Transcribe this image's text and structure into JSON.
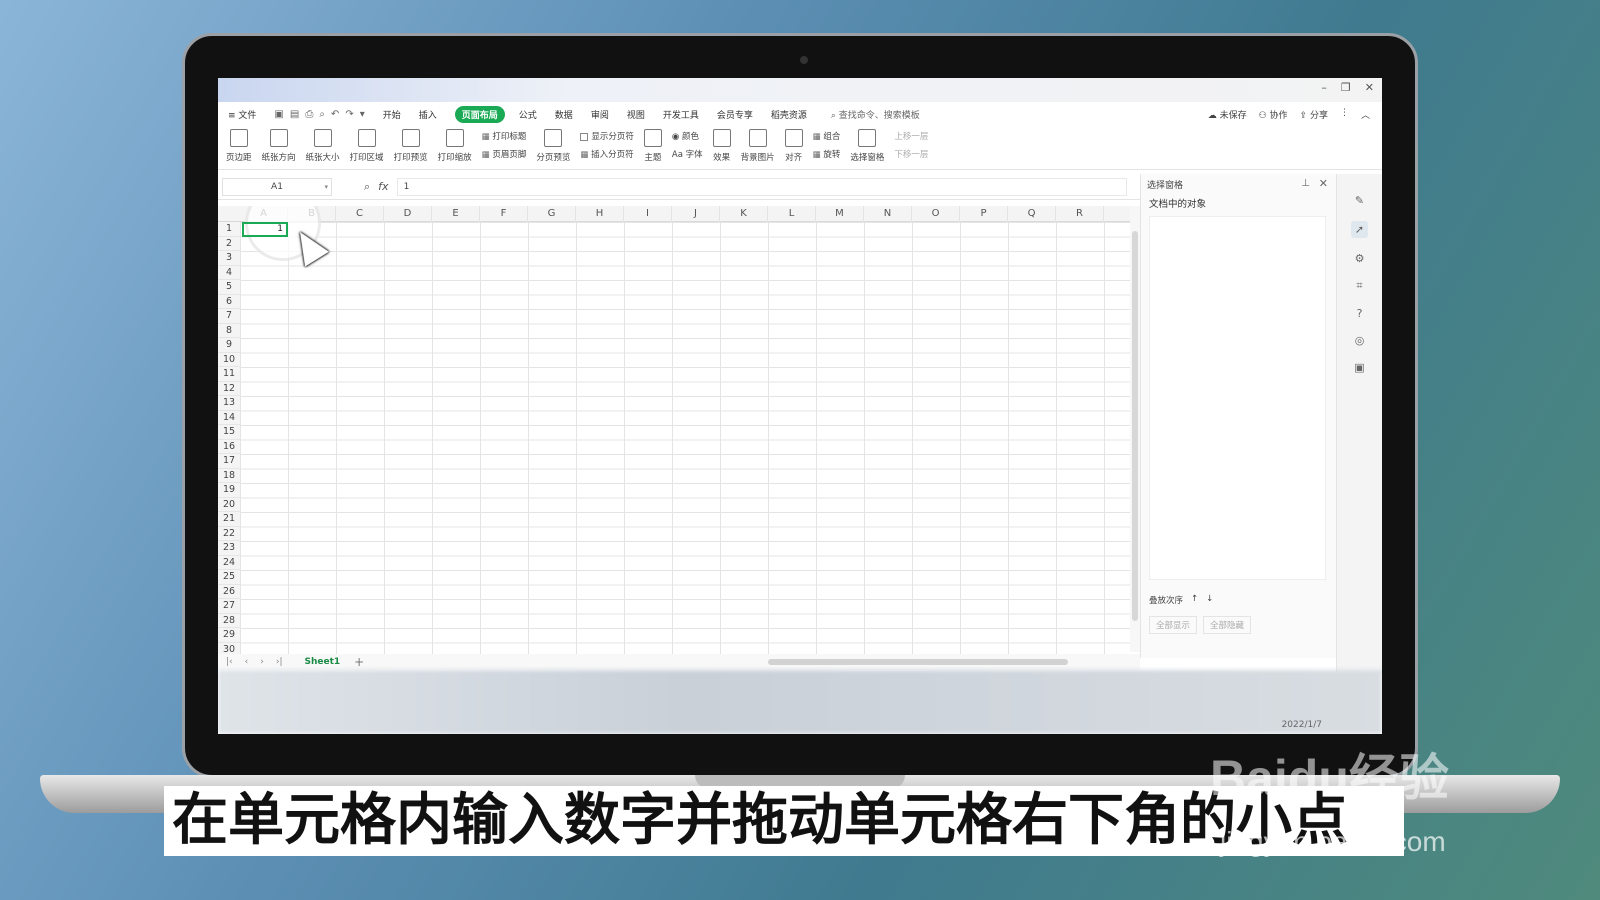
{
  "window": {
    "minimize": "–",
    "restore": "❐",
    "close": "✕"
  },
  "menu": {
    "file": "≡ 文件",
    "tabs": [
      "开始",
      "插入",
      "页面布局",
      "公式",
      "数据",
      "审阅",
      "视图",
      "开发工具",
      "会员专享",
      "稻壳资源"
    ],
    "active_tab": "页面布局",
    "search": "查找命令、搜索模板",
    "unsaved": "未保存",
    "collab": "协作",
    "share": "分享"
  },
  "ribbon": {
    "margins": "页边距",
    "orientation": "纸张方向",
    "size": "纸张大小",
    "print_area": "打印区域",
    "print_preview": "打印预览",
    "print_scale": "打印缩放",
    "print_titles": "打印标题",
    "header_footer": "页眉页脚",
    "page_break_preview": "分页预览",
    "show_page_breaks": "显示分页符",
    "insert_page_break": "插入分页符",
    "theme": "主题",
    "colors": "颜色",
    "fonts": "Aa 字体",
    "effects": "效果",
    "background": "背景图片",
    "align": "对齐",
    "group": "组合",
    "rotate": "旋转",
    "selection_pane": "选择窗格",
    "bring_forward": "上移一层",
    "send_backward": "下移一层"
  },
  "formula_bar": {
    "name_box": "A1",
    "fx": "fx",
    "value": "1"
  },
  "grid": {
    "columns": [
      "A",
      "B",
      "C",
      "D",
      "E",
      "F",
      "G",
      "H",
      "I",
      "J",
      "K",
      "L",
      "M",
      "N",
      "O",
      "P",
      "Q",
      "R"
    ],
    "rows": [
      "1",
      "2",
      "3",
      "4",
      "5",
      "6",
      "7",
      "8",
      "9",
      "10",
      "11",
      "12",
      "13",
      "14",
      "15",
      "16",
      "17",
      "18",
      "19",
      "20",
      "21",
      "22",
      "23",
      "24",
      "25",
      "26",
      "27",
      "28",
      "29",
      "30"
    ],
    "a1_value": "1"
  },
  "sheets": {
    "tab": "Sheet1",
    "add": "+"
  },
  "pane": {
    "title": "选择窗格",
    "subtitle": "文档中的对象",
    "layer_order": "叠放次序",
    "show_all": "全部显示",
    "hide_all": "全部隐藏"
  },
  "taskbar": {
    "date": "2022/1/7"
  },
  "caption": "在单元格内输入数字并拖动单元格右下角的小点",
  "watermark": {
    "brand": "Baidu经验",
    "url": "jingyan.baidu.com"
  },
  "colors": {
    "accent": "#1aaa55"
  }
}
